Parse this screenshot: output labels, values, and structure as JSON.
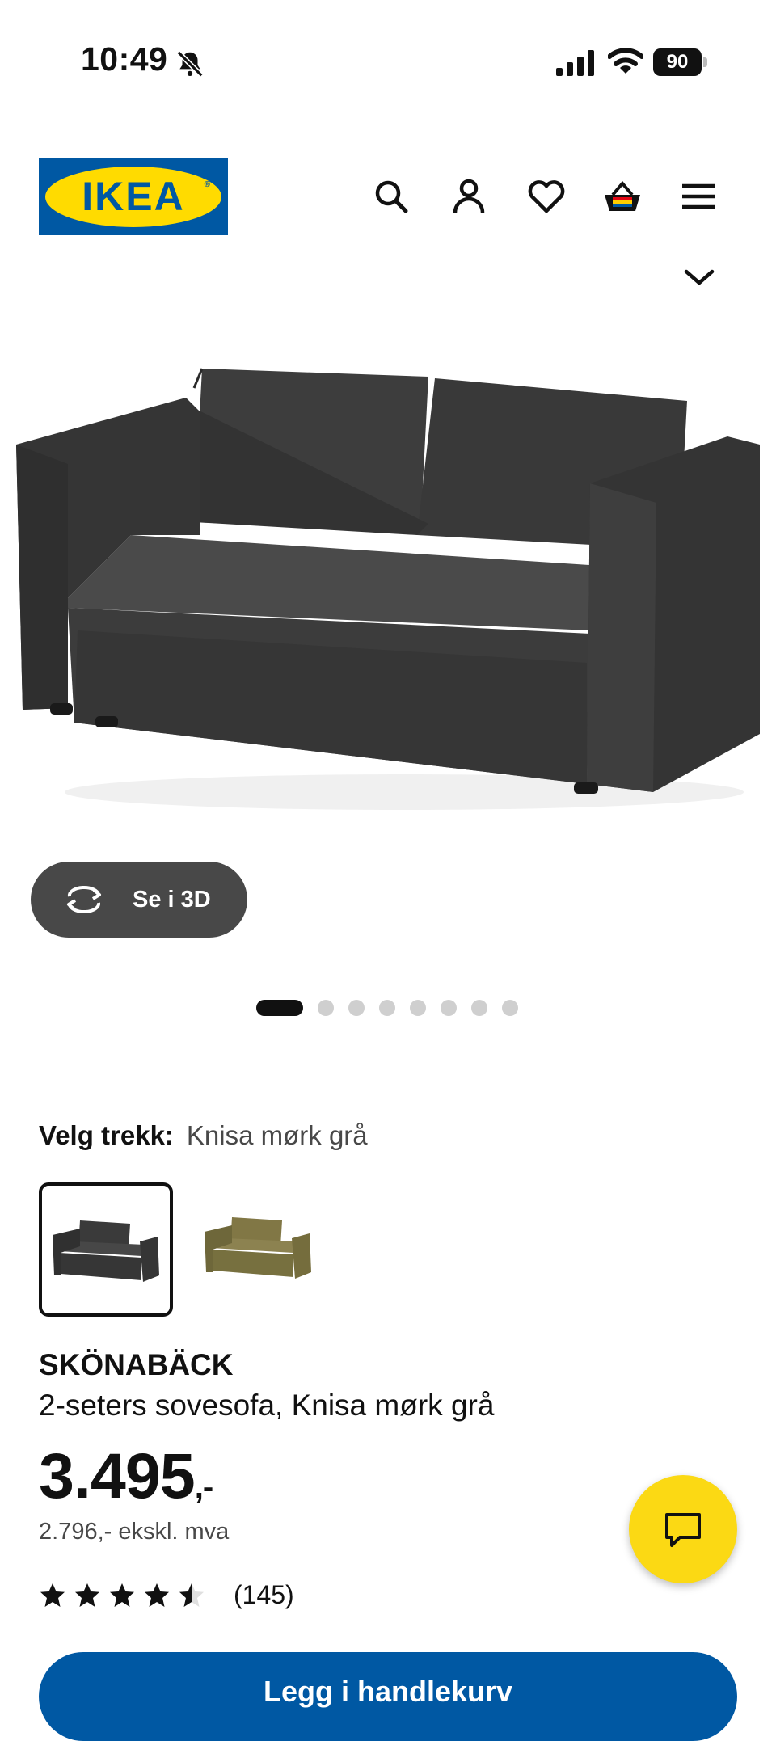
{
  "status_bar": {
    "time": "10:49",
    "battery": "90",
    "icons": [
      "bell-slash-icon",
      "signal-icon",
      "wifi-icon",
      "battery-icon"
    ]
  },
  "header": {
    "logo_text": "IKEA",
    "icons": [
      "search-icon",
      "user-icon",
      "heart-icon",
      "basket-icon",
      "menu-icon",
      "chevron-down-icon"
    ]
  },
  "hero": {
    "button_3d_label": "Se i 3D",
    "image_count": 8,
    "active_image_index": 0
  },
  "cover": {
    "label": "Velg trekk:",
    "selected_value": "Knisa mørk grå",
    "swatches": [
      {
        "color": "#3a3a3a",
        "selected": true
      },
      {
        "color": "#7d7443",
        "selected": false
      }
    ]
  },
  "product": {
    "name": "SKÖNABÄCK",
    "description": "2-seters sovesofa, Knisa mørk grå",
    "price_main": "3.495",
    "price_suffix": ",-",
    "price_ex_vat": "2.796,- ekskl. mva",
    "rating": 4.5,
    "review_count": "(145)"
  },
  "cta": {
    "label": "Legg i handlekurv"
  },
  "colors": {
    "ikea_blue": "#0058a3",
    "ikea_yellow": "#ffdb00",
    "fab_yellow": "#fbd914",
    "button_dark": "#484848"
  }
}
